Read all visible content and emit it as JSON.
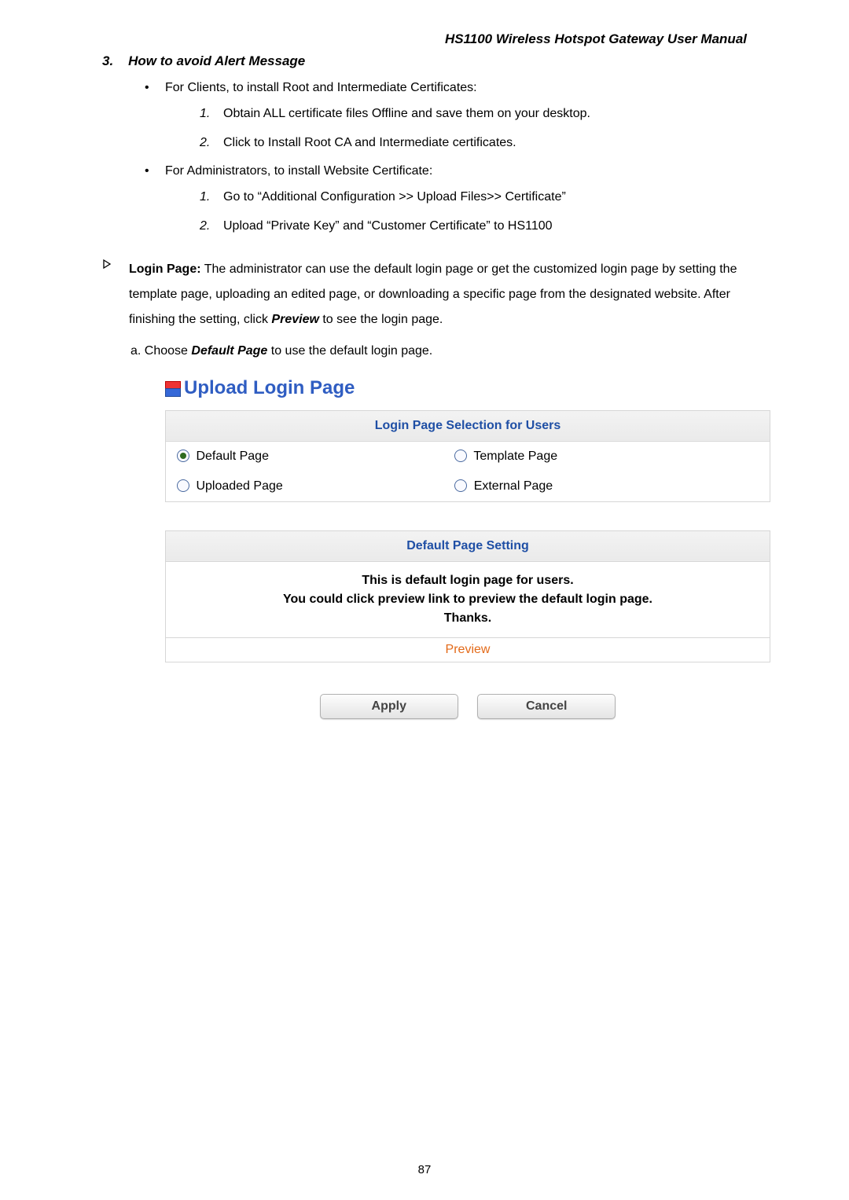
{
  "doc_title": "HS1100  Wireless  Hotspot  Gateway  User  Manual",
  "section3": {
    "num": "3.",
    "title": "How to avoid Alert Message",
    "bullet1": "For Clients, to install Root and Intermediate Certificates:",
    "b1_items": [
      "Obtain ALL certificate files Offline and save them on your desktop.",
      "Click to Install Root CA and Intermediate certificates."
    ],
    "bullet2": "For Administrators, to install Website Certificate:",
    "b2_items": [
      "Go to “Additional Configuration >> Upload Files>> Certificate”",
      "Upload “Private Key” and “Customer Certificate” to HS1100"
    ]
  },
  "login": {
    "label": "Login Page:",
    "text_after": " The administrator can use the default login page or get the customized login page by setting the template page, uploading an edited page, or downloading a specific page from the designated website. After finishing the setting, click ",
    "preview_word": "Preview",
    "text_tail": " to see the login page.",
    "sub_a_prefix": "a.    Choose ",
    "default_page_word": "Default Page",
    "sub_a_suffix": " to use the default login page."
  },
  "upload_heading": "Upload Login Page",
  "selection": {
    "header": "Login Page Selection for Users",
    "opt1": "Default Page",
    "opt2": "Template Page",
    "opt3": "Uploaded Page",
    "opt4": "External Page"
  },
  "default_setting": {
    "header": "Default Page Setting",
    "line1": "This is default login page for users.",
    "line2": "You could click preview link to preview the default login page.",
    "line3": "Thanks.",
    "preview": "Preview"
  },
  "buttons": {
    "apply": "Apply",
    "cancel": "Cancel"
  },
  "page_number": "87"
}
